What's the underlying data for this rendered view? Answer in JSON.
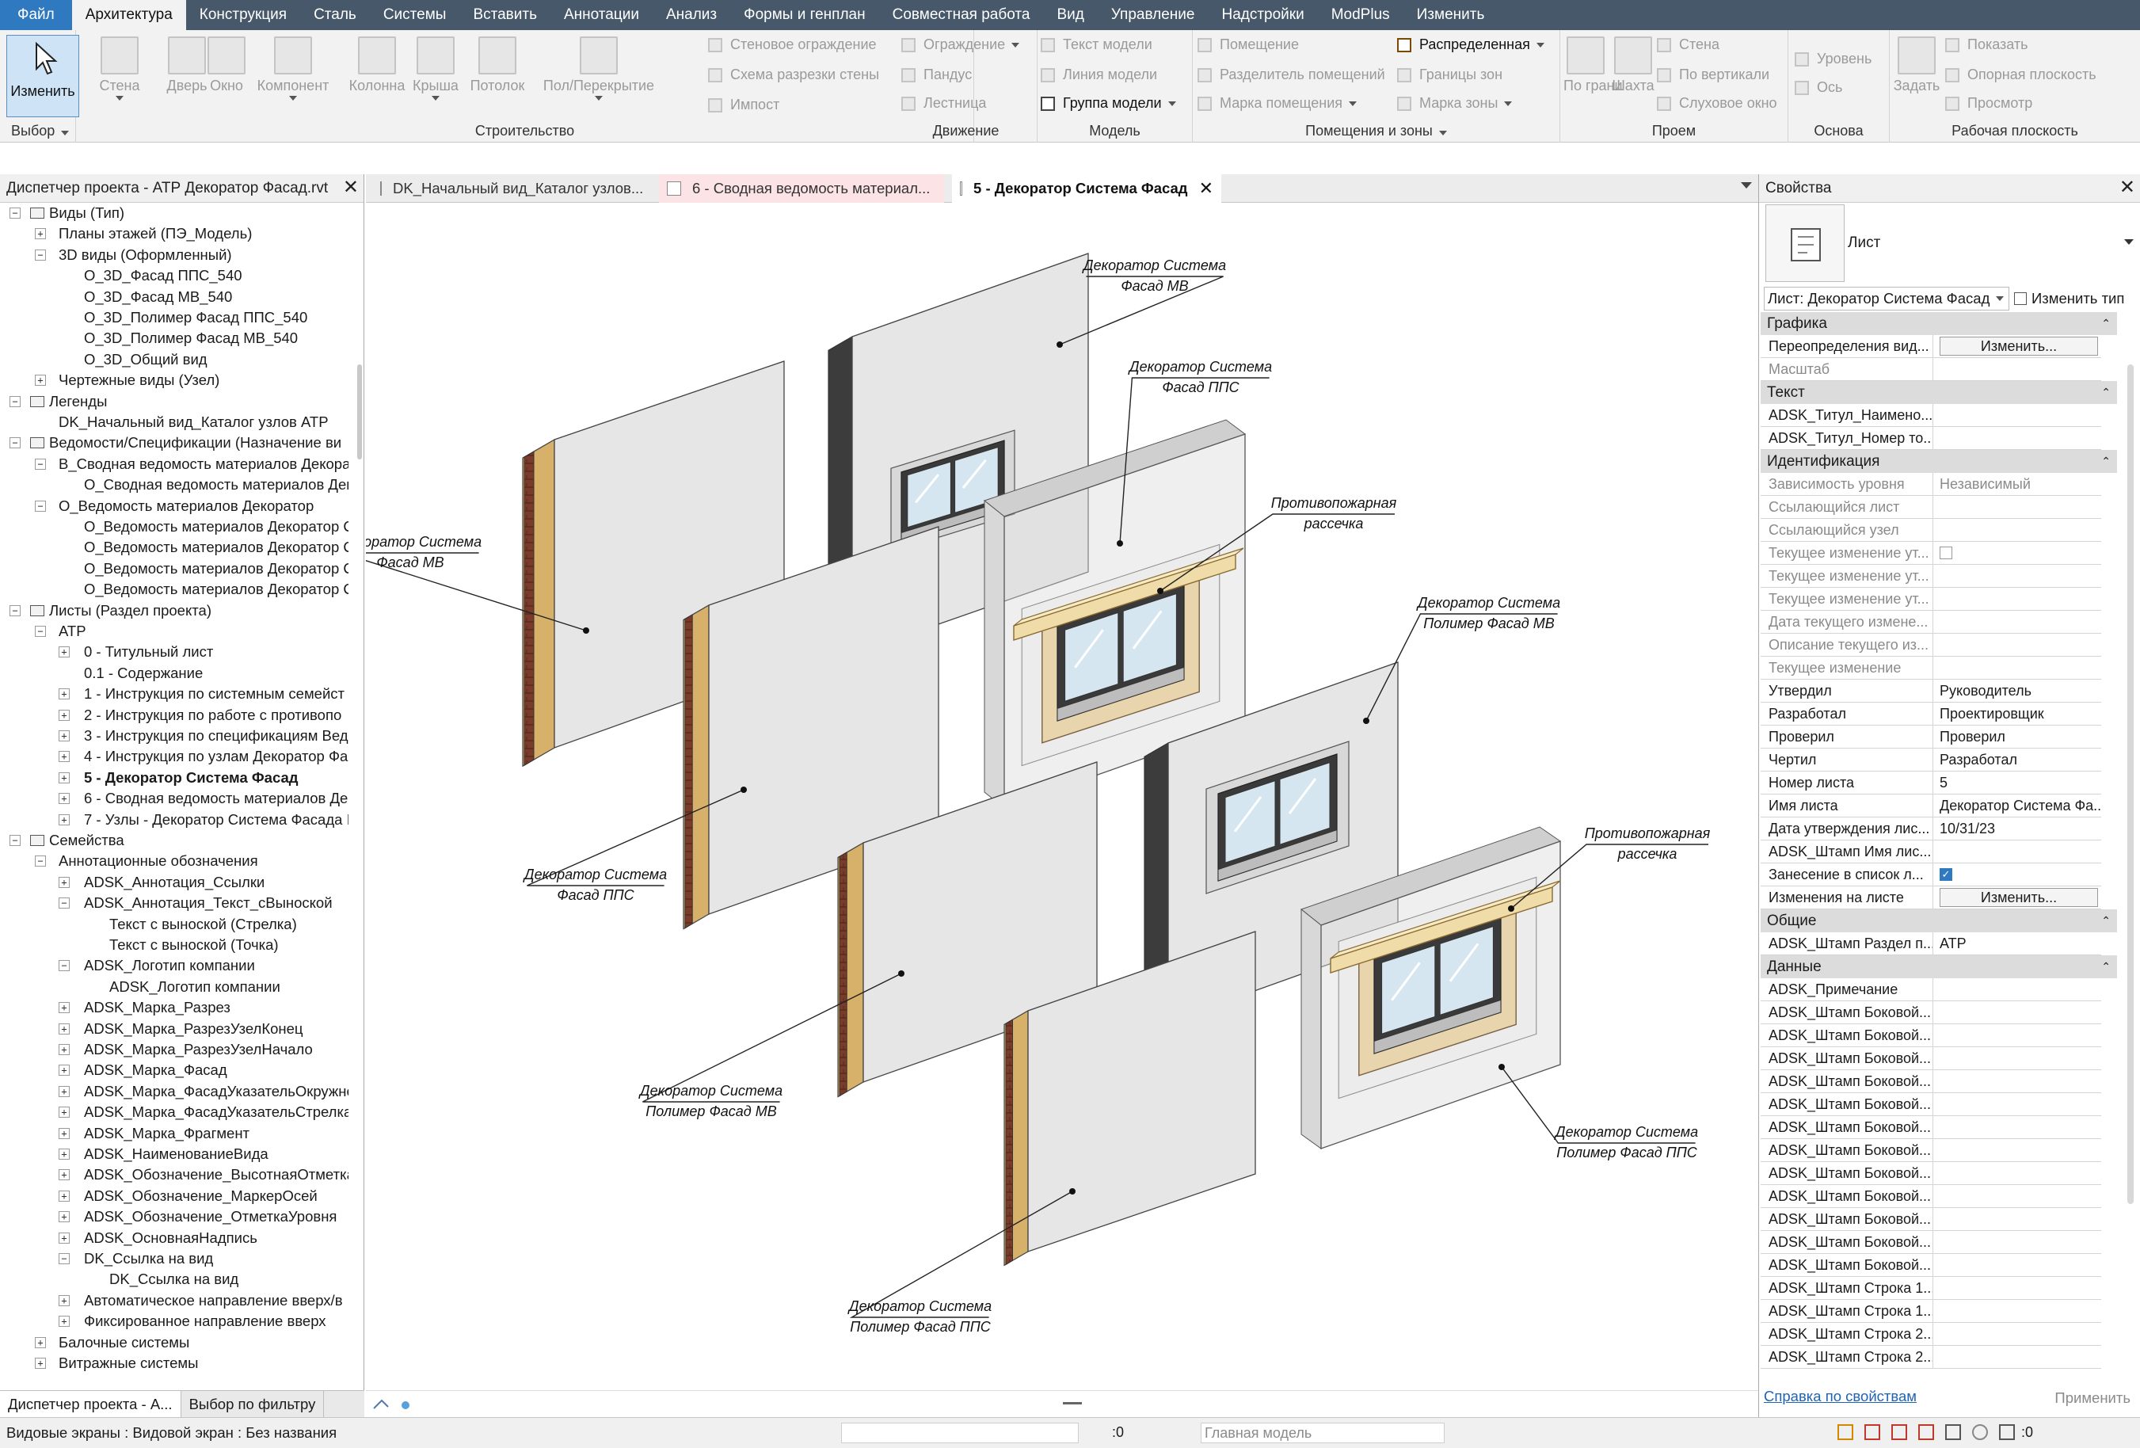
{
  "ribbon": {
    "tabs": [
      "Файл",
      "Архитектура",
      "Конструкция",
      "Сталь",
      "Системы",
      "Вставить",
      "Аннотации",
      "Анализ",
      "Формы и генплан",
      "Совместная работа",
      "Вид",
      "Управление",
      "Надстройки",
      "ModPlus",
      "Изменить"
    ],
    "active_tab": "Архитектура",
    "groups": {
      "select": {
        "label": "Выбор",
        "modify": "Изменить"
      },
      "build": {
        "label": "Строительство",
        "items": [
          "Стена",
          "Дверь",
          "Окно",
          "Компонент",
          "Колонна",
          "Крыша",
          "Потолок",
          "Пол/Перекрытие"
        ],
        "small": [
          "Стеновое ограждение",
          "Схема разрезки стены",
          "Импост"
        ]
      },
      "circulation": {
        "label": "Движение",
        "items": [
          "Ограждение",
          "Пандус",
          "Лестница"
        ]
      },
      "model": {
        "label": "Модель",
        "items": [
          "Текст модели",
          "Линия модели",
          "Группа модели"
        ]
      },
      "rooms": {
        "label": "Помещения и зоны",
        "items": [
          "Помещение",
          "Разделитель помещений",
          "Марка помещения",
          "Распределенная",
          "Границы зон",
          "Марка зоны"
        ]
      },
      "opening": {
        "label": "Проем",
        "items": [
          "По грани",
          "Шахта",
          "Стена",
          "По вертикали",
          "Слуховое окно"
        ]
      },
      "datum": {
        "label": "Основа",
        "items": [
          "Уровень",
          "Ось"
        ]
      },
      "workplane": {
        "label": "Рабочая плоскость",
        "items": [
          "Задать",
          "Показать",
          "Опорная плоскость",
          "Просмотр"
        ]
      }
    }
  },
  "browser": {
    "title": "Диспетчер проекта - АТР Декоратор Фасад.rvt",
    "rows": [
      {
        "text": "Виды (Тип)",
        "level": 0,
        "tog": "-",
        "icon": true
      },
      {
        "text": "Планы этажей (ПЭ_Модель)",
        "level": 1,
        "tog": "+"
      },
      {
        "text": "3D виды (Оформленный)",
        "level": 1,
        "tog": "-"
      },
      {
        "text": "О_3D_Фасад ППС_540",
        "level": 2
      },
      {
        "text": "О_3D_Фасад МВ_540",
        "level": 2
      },
      {
        "text": "О_3D_Полимер Фасад ППС_540",
        "level": 2
      },
      {
        "text": "О_3D_Полимер Фасад МВ_540",
        "level": 2
      },
      {
        "text": "О_3D_Общий вид",
        "level": 2
      },
      {
        "text": "Чертежные виды (Узел)",
        "level": 1,
        "tog": "+"
      },
      {
        "text": "Легенды",
        "level": 0,
        "tog": "-",
        "icon": true
      },
      {
        "text": "DK_Начальный вид_Каталог узлов АТР",
        "level": 1
      },
      {
        "text": "Ведомости/Спецификации (Назначение ви",
        "level": 0,
        "tog": "-",
        "icon": true
      },
      {
        "text": "В_Сводная ведомость материалов Декорат",
        "level": 1,
        "tog": "-"
      },
      {
        "text": "О_Сводная ведомость материалов Дек",
        "level": 2
      },
      {
        "text": "О_Ведомость материалов Декоратор",
        "level": 1,
        "tog": "-"
      },
      {
        "text": "О_Ведомость материалов Декоратор С",
        "level": 2
      },
      {
        "text": "О_Ведомость материалов Декоратор С",
        "level": 2
      },
      {
        "text": "О_Ведомость материалов Декоратор С",
        "level": 2
      },
      {
        "text": "О_Ведомость материалов Декоратор С",
        "level": 2
      },
      {
        "text": "Листы (Раздел проекта)",
        "level": 0,
        "tog": "-",
        "icon": true
      },
      {
        "text": "АТР",
        "level": 1,
        "tog": "-"
      },
      {
        "text": "0 - Титульный лист",
        "level": 2,
        "tog": "+"
      },
      {
        "text": "0.1 - Содержание",
        "level": 2
      },
      {
        "text": "1 - Инструкция по системным семейст",
        "level": 2,
        "tog": "+"
      },
      {
        "text": "2 - Инструкция по работе с противопо",
        "level": 2,
        "tog": "+"
      },
      {
        "text": "3 - Инструкция по спецификациям Вед",
        "level": 2,
        "tog": "+"
      },
      {
        "text": "4 - Инструкция по узлам Декоратор Фа",
        "level": 2,
        "tog": "+"
      },
      {
        "text": "5 - Декоратор Система Фасад",
        "level": 2,
        "tog": "+",
        "sel": true
      },
      {
        "text": "6 - Сводная ведомость материалов Де",
        "level": 2,
        "tog": "+"
      },
      {
        "text": "7 - Узлы - Декоратор Система Фасада I",
        "level": 2,
        "tog": "+"
      },
      {
        "text": "Семейства",
        "level": 0,
        "tog": "-",
        "icon": true
      },
      {
        "text": "Аннотационные обозначения",
        "level": 1,
        "tog": "-"
      },
      {
        "text": "ADSK_Аннотация_Ссылки",
        "level": 2,
        "tog": "+"
      },
      {
        "text": "ADSK_Аннотация_Текст_сВыноской",
        "level": 2,
        "tog": "-"
      },
      {
        "text": "Текст с выноской (Стрелка)",
        "level": 3
      },
      {
        "text": "Текст с выноской (Точка)",
        "level": 3
      },
      {
        "text": "ADSK_Логотип компании",
        "level": 2,
        "tog": "-"
      },
      {
        "text": "ADSK_Логотип компании",
        "level": 3
      },
      {
        "text": "ADSK_Марка_Разрез",
        "level": 2,
        "tog": "+"
      },
      {
        "text": "ADSK_Марка_РазрезУзелКонец",
        "level": 2,
        "tog": "+"
      },
      {
        "text": "ADSK_Марка_РазрезУзелНачало",
        "level": 2,
        "tog": "+"
      },
      {
        "text": "ADSK_Марка_Фасад",
        "level": 2,
        "tog": "+"
      },
      {
        "text": "ADSK_Марка_ФасадУказательОкружно",
        "level": 2,
        "tog": "+"
      },
      {
        "text": "ADSK_Марка_ФасадУказательСтрелка",
        "level": 2,
        "tog": "+"
      },
      {
        "text": "ADSK_Марка_Фрагмент",
        "level": 2,
        "tog": "+"
      },
      {
        "text": "ADSK_НаименованиеВида",
        "level": 2,
        "tog": "+"
      },
      {
        "text": "ADSK_Обозначение_ВысотнаяОтметка",
        "level": 2,
        "tog": "+"
      },
      {
        "text": "ADSK_Обозначение_МаркерОсей",
        "level": 2,
        "tog": "+"
      },
      {
        "text": "ADSK_Обозначение_ОтметкаУровня",
        "level": 2,
        "tog": "+"
      },
      {
        "text": "ADSK_ОсновнаяНадпись",
        "level": 2,
        "tog": "+"
      },
      {
        "text": "DK_Ссылка на вид",
        "level": 2,
        "tog": "-"
      },
      {
        "text": "DK_Ссылка на вид",
        "level": 3
      },
      {
        "text": "Автоматическое направление вверх/в",
        "level": 2,
        "tog": "+"
      },
      {
        "text": "Фиксированное направление вверх",
        "level": 2,
        "tog": "+"
      },
      {
        "text": "Балочные системы",
        "level": 1,
        "tog": "+"
      },
      {
        "text": "Витражные системы",
        "level": 1,
        "tog": "+"
      }
    ],
    "bottom_tabs": [
      "Диспетчер проекта - А...",
      "Выбор по фильтру"
    ]
  },
  "doc_tabs": [
    {
      "label": "DK_Начальный вид_Каталог узлов..."
    },
    {
      "label": "6 - Сводная ведомость материал..."
    },
    {
      "label": "5 - Декоратор Система Фасад"
    }
  ],
  "drawing": {
    "labels": [
      [
        "Декоратор Система",
        "Фасад МВ"
      ],
      [
        "Декоратор Система",
        "Фасад ППС"
      ],
      [
        "Противопожарная",
        "рассечка"
      ],
      [
        "Декоратор Система",
        "Полимер Фасад МВ"
      ],
      [
        "Декоратор Система",
        "Фасад МВ"
      ],
      [
        "Декоратор Система",
        "Фасад ППС"
      ],
      [
        "Противопожарная",
        "рассечка"
      ],
      [
        "Декоратор Система",
        "Полимер Фасад МВ"
      ],
      [
        "Декоратор Система",
        "Полимер Фасад ППС"
      ],
      [
        "Декоратор Система",
        "Полимер Фасад ППС"
      ]
    ]
  },
  "properties": {
    "title": "Свойства",
    "type_name": "Лист",
    "sheet_selector": "Лист: Декоратор Система Фасад",
    "edit_type": "Изменить тип",
    "sections": [
      {
        "name": "Графика",
        "rows": [
          [
            "Переопределения вид...",
            "Изменить...",
            "btn"
          ],
          [
            "Масштаб",
            "",
            "g"
          ]
        ]
      },
      {
        "name": "Текст",
        "rows": [
          [
            "ADSK_Титул_Наимено...",
            ""
          ],
          [
            "ADSK_Титул_Номер то...",
            ""
          ]
        ]
      },
      {
        "name": "Идентификация",
        "rows": [
          [
            "Зависимость уровня",
            "Независимый",
            "g"
          ],
          [
            "Ссылающийся лист",
            "",
            "g"
          ],
          [
            "Ссылающийся узел",
            "",
            "g"
          ],
          [
            "Текущее изменение ут...",
            "",
            "gcb"
          ],
          [
            "Текущее изменение ут...",
            "",
            "g"
          ],
          [
            "Текущее изменение ут...",
            "",
            "g"
          ],
          [
            "Дата текущего измене...",
            "",
            "g"
          ],
          [
            "Описание текущего из...",
            "",
            "g"
          ],
          [
            "Текущее изменение",
            "",
            "g"
          ],
          [
            "Утвердил",
            "Руководитель"
          ],
          [
            "Разработал",
            "Проектировщик"
          ],
          [
            "Проверил",
            "Проверил"
          ],
          [
            "Чертил",
            "Разработал"
          ],
          [
            "Номер листа",
            "5"
          ],
          [
            "Имя листа",
            "Декоратор Система Фа..."
          ],
          [
            "Дата утверждения лис...",
            "10/31/23"
          ],
          [
            "ADSK_Штамп Имя лис...",
            ""
          ],
          [
            "Занесение в список л...",
            "",
            "cb"
          ],
          [
            "Изменения на листе",
            "Изменить...",
            "btn"
          ]
        ]
      },
      {
        "name": "Общие",
        "rows": [
          [
            "ADSK_Штамп Раздел п...",
            "АТР"
          ]
        ]
      },
      {
        "name": "Данные",
        "rows": [
          [
            "ADSK_Примечание",
            ""
          ],
          [
            "ADSK_Штамп Боковой...",
            ""
          ],
          [
            "ADSK_Штамп Боковой...",
            ""
          ],
          [
            "ADSK_Штамп Боковой...",
            ""
          ],
          [
            "ADSK_Штамп Боковой...",
            ""
          ],
          [
            "ADSK_Штамп Боковой...",
            ""
          ],
          [
            "ADSK_Штамп Боковой...",
            ""
          ],
          [
            "ADSK_Штамп Боковой...",
            ""
          ],
          [
            "ADSK_Штамп Боковой...",
            ""
          ],
          [
            "ADSK_Штамп Боковой...",
            ""
          ],
          [
            "ADSK_Штамп Боковой...",
            ""
          ],
          [
            "ADSK_Штамп Боковой...",
            ""
          ],
          [
            "ADSK_Штамп Боковой...",
            ""
          ],
          [
            "ADSK_Штамп Строка 1...",
            ""
          ],
          [
            "ADSK_Штамп Строка 1...",
            ""
          ],
          [
            "ADSK_Штамп Строка 2...",
            ""
          ],
          [
            "ADSK_Штамп Строка 2...",
            ""
          ]
        ]
      }
    ],
    "help_link": "Справка по свойствам",
    "apply": "Применить"
  },
  "status": {
    "text": "Видовые экраны : Видовой экран : Без названия",
    "model": "Главная модель",
    "zero1": ":0",
    "zero2": ":0"
  }
}
